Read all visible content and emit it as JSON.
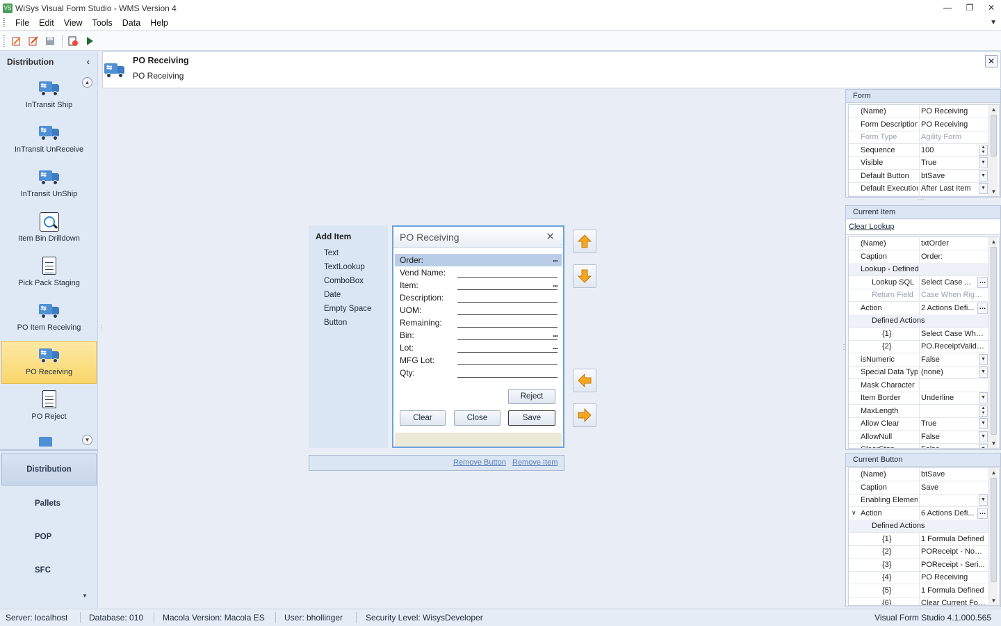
{
  "window": {
    "title": "WiSys Visual Form Studio - WMS Version 4"
  },
  "menu": [
    "File",
    "Edit",
    "View",
    "Tools",
    "Data",
    "Help"
  ],
  "toolbar": {
    "icons": [
      "new-form-icon",
      "edit-form-icon",
      "save-icon",
      "delete-icon",
      "run-icon"
    ]
  },
  "sidebar": {
    "header": "Distribution",
    "items": [
      {
        "label": "InTransit Ship",
        "icon": "truck-icon"
      },
      {
        "label": "InTransit UnReceive",
        "icon": "truck-icon"
      },
      {
        "label": "InTransit UnShip",
        "icon": "truck-icon"
      },
      {
        "label": "Item Bin Drilldown",
        "icon": "magnifier-icon"
      },
      {
        "label": "Pick Pack Staging",
        "icon": "document-icon"
      },
      {
        "label": "PO Item Receiving",
        "icon": "truck-icon"
      },
      {
        "label": "PO Receiving",
        "icon": "truck-icon",
        "selected": true
      },
      {
        "label": "PO Reject",
        "icon": "document-icon"
      }
    ],
    "groups": [
      "Distribution",
      "Pallets",
      "POP",
      "SFC"
    ]
  },
  "header": {
    "title": "PO Receiving",
    "subtitle": "PO Receiving"
  },
  "add_item": {
    "title": "Add Item",
    "options": [
      "Text",
      "TextLookup",
      "ComboBox",
      "Date",
      "Empty Space",
      "Button"
    ]
  },
  "form_preview": {
    "title": "PO Receiving",
    "fields": [
      {
        "label": "Order:",
        "lookup": true,
        "selected": true
      },
      {
        "label": "Vend Name:"
      },
      {
        "label": "Item:",
        "lookup": true
      },
      {
        "label": "Description:"
      },
      {
        "label": "UOM:"
      },
      {
        "label": "Remaining:"
      },
      {
        "label": "Bin:",
        "lookup": true
      },
      {
        "label": "Lot:",
        "lookup": true
      },
      {
        "label": "MFG Lot:"
      },
      {
        "label": "Qty:"
      }
    ],
    "buttons": {
      "reject": "Reject",
      "clear": "Clear",
      "close": "Close",
      "save": "Save"
    },
    "lookup_glyph": "..."
  },
  "actions": {
    "remove_button": "Remove Button",
    "remove_item": "Remove Item"
  },
  "form_props": {
    "header": "Form",
    "rows": [
      {
        "k": "(Name)",
        "v": "PO Receiving"
      },
      {
        "k": "Form Description",
        "v": "PO Receiving"
      },
      {
        "k": "Form Type",
        "v": "Agility Form",
        "disabled": true
      },
      {
        "k": "Sequence",
        "v": "100",
        "ctl": "spin"
      },
      {
        "k": "Visible",
        "v": "True",
        "ctl": "dd"
      },
      {
        "k": "Default Button",
        "v": "btSave",
        "ctl": "dd"
      },
      {
        "k": "Default Executior",
        "v": "After Last Item",
        "ctl": "dd"
      }
    ]
  },
  "item_props": {
    "header": "Current Item",
    "clear_lookup": "Clear Lookup",
    "rows": [
      {
        "k": "(Name)",
        "v": "txtOrder"
      },
      {
        "k": "Caption",
        "v": "Order:"
      },
      {
        "k": "Lookup - Defined",
        "v": "",
        "cat": true
      },
      {
        "k": "Lookup SQL",
        "v": "Select Case ...",
        "sub": 1,
        "ctl": "ell"
      },
      {
        "k": "Return Field",
        "v": "Case When Right...",
        "sub": 1,
        "disabled": true
      },
      {
        "k": "Action",
        "v": "2 Actions Defi...",
        "ctl": "ell"
      },
      {
        "k": "Defined Actions",
        "v": "",
        "cat": true,
        "sub": 1
      },
      {
        "k": "{1}",
        "v": "Select Case Whe...",
        "sub": 2
      },
      {
        "k": "{2}",
        "v": "PO.ReceiptValida...",
        "sub": 2
      },
      {
        "k": "isNumeric",
        "v": "False",
        "ctl": "dd"
      },
      {
        "k": "Special Data Typ",
        "v": "(none)",
        "ctl": "dd"
      },
      {
        "k": "Mask Character",
        "v": ""
      },
      {
        "k": "Item Border",
        "v": "Underline",
        "ctl": "dd"
      },
      {
        "k": "MaxLength",
        "v": "",
        "ctl": "spin"
      },
      {
        "k": "Allow Clear",
        "v": "True",
        "ctl": "dd"
      },
      {
        "k": "AllowNull",
        "v": "False",
        "ctl": "dd"
      },
      {
        "k": "ClearStop",
        "v": "False",
        "ctl": "dd"
      }
    ]
  },
  "button_props": {
    "header": "Current Button",
    "rows": [
      {
        "k": "(Name)",
        "v": "btSave"
      },
      {
        "k": "Caption",
        "v": "Save"
      },
      {
        "k": "Enabling Element",
        "v": "",
        "ctl": "dd"
      },
      {
        "k": "Action",
        "v": "6 Actions Defi...",
        "ctl": "ell",
        "expander": true
      },
      {
        "k": "Defined Actions",
        "v": "",
        "cat": true,
        "sub": 1
      },
      {
        "k": "{1}",
        "v": "1 Formula Defined",
        "sub": 2
      },
      {
        "k": "{2}",
        "v": "POReceipt - Non ...",
        "sub": 2
      },
      {
        "k": "{3}",
        "v": "POReceipt - Seri...",
        "sub": 2
      },
      {
        "k": "{4}",
        "v": "PO Receiving",
        "sub": 2
      },
      {
        "k": "{5}",
        "v": "1 Formula Defined",
        "sub": 2
      },
      {
        "k": "{6}",
        "v": "Clear Current Form",
        "sub": 2
      }
    ]
  },
  "status": {
    "server": "Server: localhost",
    "database": "Database: 010",
    "macola": "Macola Version: Macola ES",
    "user": "User: bhollinger",
    "security": "Security Level: WisysDeveloper",
    "version": "Visual Form Studio 4.1.000.565"
  },
  "colors": {
    "accent": "#4f8fd4",
    "selection": "#f9d66a",
    "arrow": "#f5a623"
  }
}
